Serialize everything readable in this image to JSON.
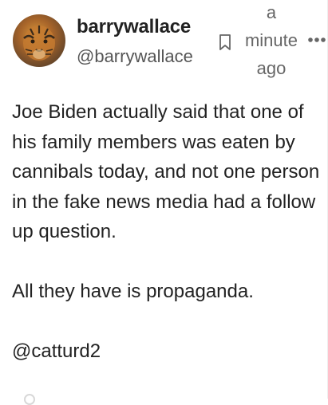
{
  "post": {
    "author": {
      "display_name": "barrywallace",
      "handle": "@barrywallace",
      "avatar": "tiger-avatar"
    },
    "time_lines": [
      "a",
      "minute",
      "ago"
    ],
    "icons": {
      "bookmark": "bookmark-icon",
      "more": "more-options-icon"
    },
    "paragraphs": [
      "Joe Biden actually said that one of his family members was eaten by cannibals today, and not one person in the fake news media had a follow up question.",
      "All they have is propaganda.",
      "@catturd2"
    ]
  },
  "colors": {
    "text": "#222222",
    "secondary": "#555555",
    "icon": "#666666"
  }
}
